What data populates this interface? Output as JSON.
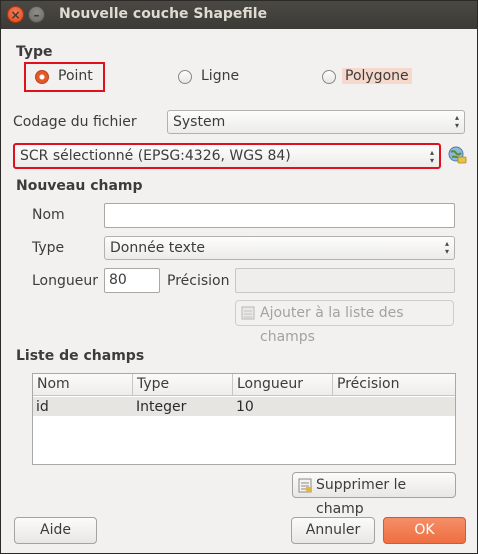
{
  "window": {
    "title": "Nouvelle couche Shapefile"
  },
  "type_section": {
    "label": "Type",
    "options": [
      {
        "label": "Point",
        "selected": true
      },
      {
        "label": "Ligne",
        "selected": false
      },
      {
        "label": "Polygone",
        "selected": false
      }
    ]
  },
  "encoding": {
    "label": "Codage du fichier",
    "value": "System"
  },
  "crs": {
    "value": "SCR sélectionné (EPSG:4326, WGS 84)",
    "icon": "globe-select-icon"
  },
  "new_field": {
    "label": "Nouveau champ",
    "name_label": "Nom",
    "name_value": "",
    "type_label": "Type",
    "type_value": "Donnée texte",
    "length_label": "Longueur",
    "length_value": "80",
    "precision_label": "Précision",
    "precision_value": "",
    "add_button": "Ajouter à la liste des champs"
  },
  "fields_list": {
    "label": "Liste de champs",
    "columns": [
      "Nom",
      "Type",
      "Longueur",
      "Précision"
    ],
    "rows": [
      [
        "id",
        "Integer",
        "10",
        ""
      ]
    ],
    "remove_button": "Supprimer le champ"
  },
  "footer": {
    "help": "Aide",
    "cancel": "Annuler",
    "ok": "OK"
  },
  "colors": {
    "accent": "#ef6f42",
    "highlight_box": "#e0101d",
    "titlebar": "#3c3b37"
  }
}
